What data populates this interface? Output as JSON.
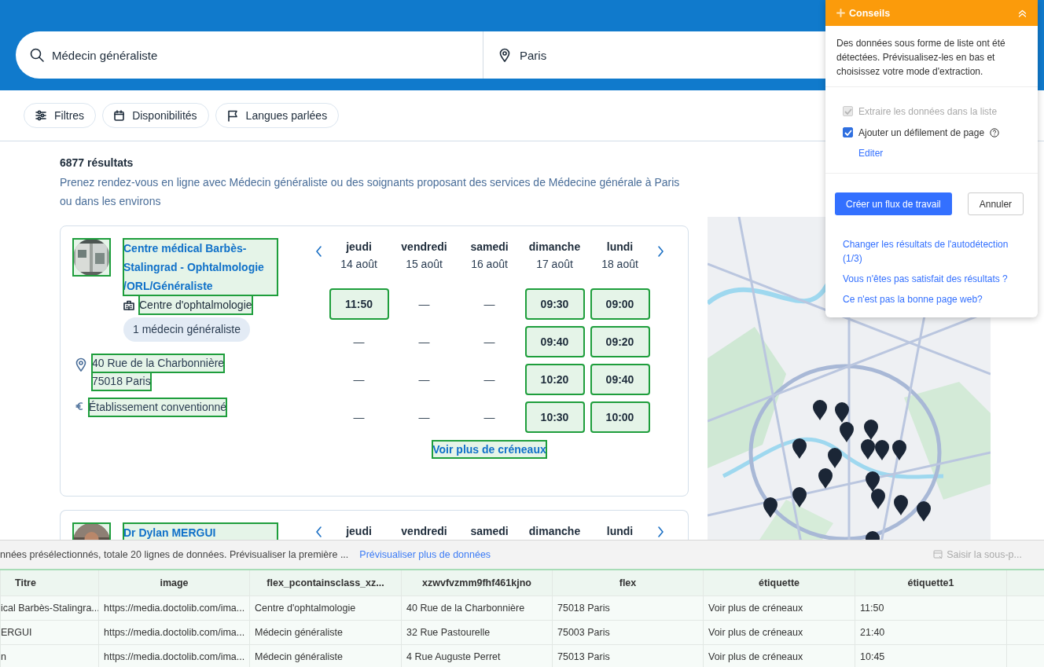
{
  "search": {
    "query": "Médecin généraliste",
    "location": "Paris"
  },
  "filters": [
    {
      "kind": "sliders",
      "label": "Filtres"
    },
    {
      "kind": "calendar",
      "label": "Disponibilités"
    },
    {
      "kind": "flag",
      "label": "Langues parlées"
    }
  ],
  "results": {
    "count": "6877 résultats",
    "description": "Prenez rendez-vous en ligne avec Médecin généraliste ou des soignants proposant des services de Médecine générale à Paris ou dans les environs"
  },
  "cards": [
    {
      "highlighted": true,
      "name": "Centre médical Barbès-Stalingrad - Ophtalmologie /ORL/Généraliste",
      "type": "Centre d'ophtalmologie",
      "badge": "1 médecin généraliste",
      "address": [
        "40 Rue de la Charbonnière",
        "75018 Paris"
      ],
      "convention": "Établissement conventionné",
      "days": [
        {
          "day": "jeudi",
          "date": "14 août"
        },
        {
          "day": "vendredi",
          "date": "15 août"
        },
        {
          "day": "samedi",
          "date": "16 août"
        },
        {
          "day": "dimanche",
          "date": "17 août"
        },
        {
          "day": "lundi",
          "date": "18 août"
        }
      ],
      "slots": [
        [
          {
            "time": "11:50",
            "available": true
          },
          {
            "time": "—",
            "available": false
          },
          {
            "time": "—",
            "available": false
          },
          {
            "time": "09:30",
            "available": true
          },
          {
            "time": "09:00",
            "available": true
          }
        ],
        [
          {
            "time": "—",
            "available": false
          },
          {
            "time": "—",
            "available": false
          },
          {
            "time": "—",
            "available": false
          },
          {
            "time": "09:40",
            "available": true
          },
          {
            "time": "09:20",
            "available": true
          }
        ],
        [
          {
            "time": "—",
            "available": false
          },
          {
            "time": "—",
            "available": false
          },
          {
            "time": "—",
            "available": false
          },
          {
            "time": "10:20",
            "available": true
          },
          {
            "time": "09:40",
            "available": true
          }
        ],
        [
          {
            "time": "—",
            "available": false
          },
          {
            "time": "—",
            "available": false
          },
          {
            "time": "—",
            "available": false
          },
          {
            "time": "10:30",
            "available": true
          },
          {
            "time": "10:00",
            "available": true
          }
        ]
      ],
      "more": "Voir plus de créneaux"
    },
    {
      "highlighted": true,
      "name": "Dr Dylan MERGUI",
      "days": [
        {
          "day": "jeudi"
        },
        {
          "day": "vendredi"
        },
        {
          "day": "samedi"
        },
        {
          "day": "dimanche"
        },
        {
          "day": "lundi"
        }
      ]
    }
  ],
  "panel": {
    "title": "Conseils",
    "message": "Des données sous forme de liste ont été détectées. Prévisualisez-les en bas et choisissez votre mode d'extraction.",
    "options": [
      {
        "label": "Extraire les données dans la liste",
        "checked": true,
        "disabled": true
      },
      {
        "label": "Ajouter un défilement de page",
        "checked": true,
        "disabled": false,
        "help": true
      }
    ],
    "edit_link": "Editer",
    "buttons": [
      {
        "label": "Créer un flux de travail",
        "kind": "primary"
      },
      {
        "label": "Annuler",
        "kind": "secondary"
      }
    ],
    "links": [
      "Changer les résultats de l'autodétection (1/3)",
      "Vous n'êtes pas satisfait des résultats ?",
      "Ce n'est pas la bonne page web?"
    ]
  },
  "preview": {
    "info": "nnées présélectionnés, totale 20 lignes de données. Prévisualiser la première ...",
    "more_link": "Prévisualiser plus de données",
    "subpage_button": {
      "label": "Saisir la sous-p...",
      "disabled": true
    }
  },
  "table": {
    "columns": [
      "Titre",
      "image",
      "flex_pcontainsclass_xz...",
      "xzwvfvzmm9fhf461kjno",
      "flex",
      "étiquette",
      "étiquette1"
    ],
    "rows": [
      [
        "ical Barbès-Stalingra...",
        "https://media.doctolib.com/ima...",
        "Centre d'ophtalmologie",
        "40 Rue de la Charbonnière",
        "75018 Paris",
        "Voir plus de créneaux",
        "11:50"
      ],
      [
        "ERGUI",
        "https://media.doctolib.com/ima...",
        "Médecin généraliste",
        "32 Rue Pastourelle",
        "75003 Paris",
        "Voir plus de créneaux",
        "21:40"
      ],
      [
        "n",
        "https://media.doctolib.com/ima...",
        "Médecin généraliste",
        "4 Rue Auguste Perret",
        "75013 Paris",
        "Voir plus de créneaux",
        "10:45"
      ]
    ]
  }
}
